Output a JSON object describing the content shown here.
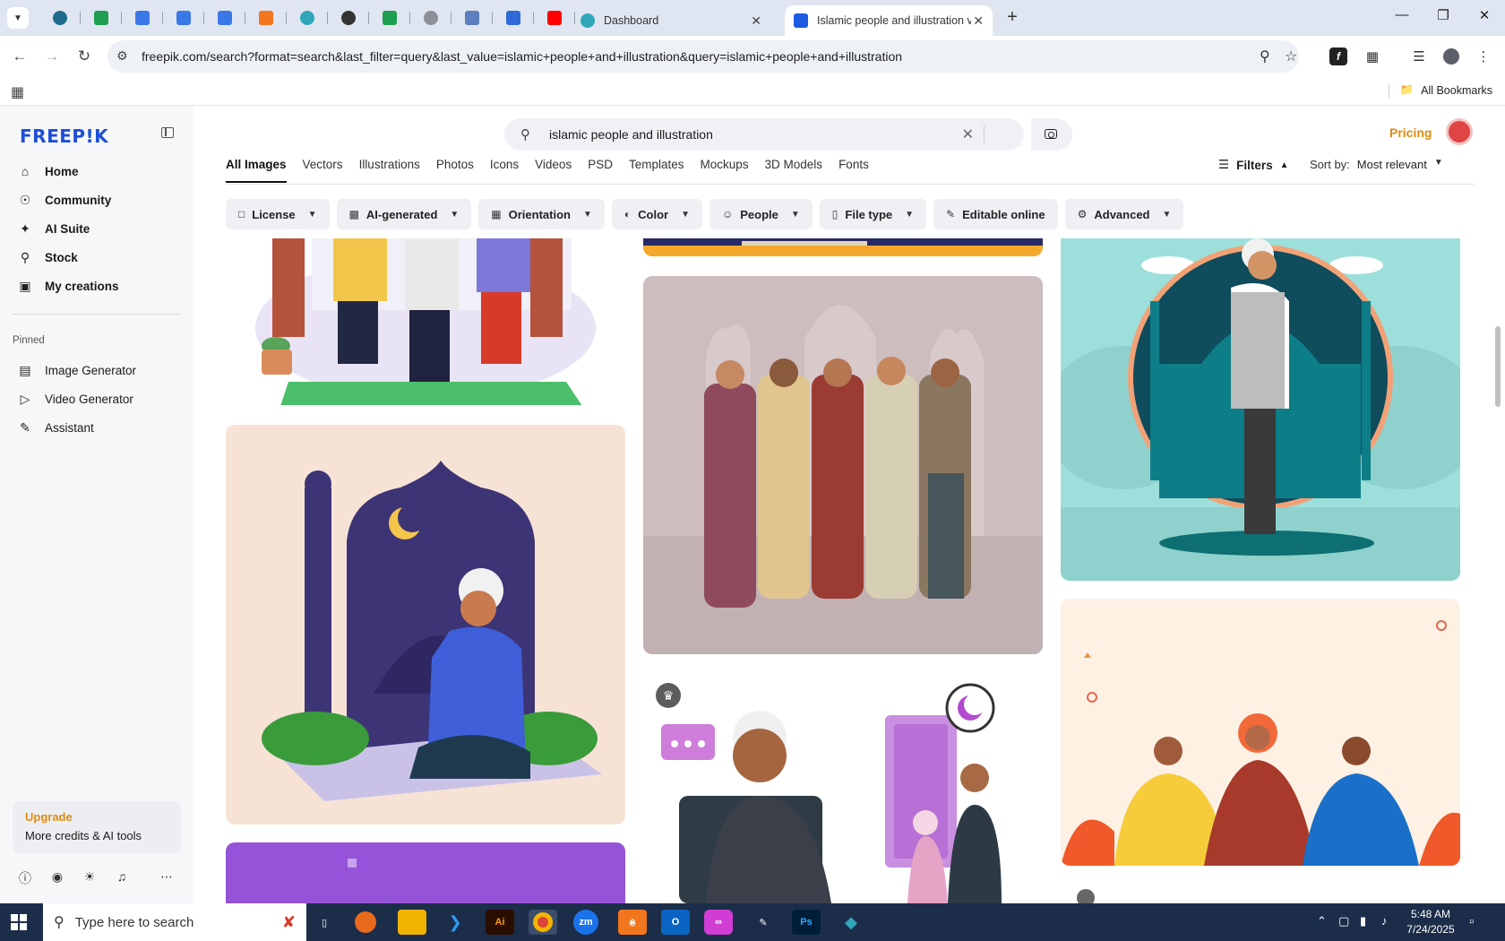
{
  "browser": {
    "tabs": [
      {
        "title": "Dashboard"
      },
      {
        "title": "Islamic people and illustration v"
      }
    ],
    "url": "freepik.com/search?format=search&last_filter=query&last_value=islamic+people+and+illustration&query=islamic+people+and+illustration",
    "bookmarks_label": "All Bookmarks",
    "colors": {
      "tabstrip": "#dfe6f1",
      "omnibox": "#eef1f6"
    }
  },
  "sidebar": {
    "logo": "FREEP!K",
    "nav": [
      {
        "label": "Home",
        "icon": "home-icon"
      },
      {
        "label": "Community",
        "icon": "globe-icon"
      },
      {
        "label": "AI Suite",
        "icon": "sparkle-icon"
      },
      {
        "label": "Stock",
        "icon": "search-icon"
      },
      {
        "label": "My creations",
        "icon": "folder-icon"
      }
    ],
    "pinned_label": "Pinned",
    "pinned": [
      {
        "label": "Image Generator",
        "icon": "image-icon"
      },
      {
        "label": "Video Generator",
        "icon": "video-icon"
      },
      {
        "label": "Assistant",
        "icon": "assistant-icon"
      }
    ],
    "upgrade": {
      "title": "Upgrade",
      "subtitle": "More credits & AI tools"
    }
  },
  "main": {
    "search_value": "islamic people and illustration",
    "pricing": "Pricing",
    "tabs": [
      "All Images",
      "Vectors",
      "Illustrations",
      "Photos",
      "Icons",
      "Videos",
      "PSD",
      "Templates",
      "Mockups",
      "3D Models",
      "Fonts"
    ],
    "active_tab": "All Images",
    "filters_label": "Filters",
    "sort_label": "Sort by:",
    "sort_value": "Most relevant",
    "chips": [
      {
        "label": "License",
        "icon": "license-icon"
      },
      {
        "label": "AI-generated",
        "icon": "ai-icon"
      },
      {
        "label": "Orientation",
        "icon": "orientation-icon"
      },
      {
        "label": "Color",
        "icon": "palette-icon"
      },
      {
        "label": "People",
        "icon": "people-icon"
      },
      {
        "label": "File type",
        "icon": "file-icon"
      },
      {
        "label": "Editable online",
        "icon": "pen-icon"
      },
      {
        "label": "Advanced",
        "icon": "gear-icon"
      }
    ],
    "accent": "#e08a10"
  },
  "taskbar": {
    "search_placeholder": "Type here to search",
    "time": "5:48 AM",
    "date": "7/24/2025"
  }
}
